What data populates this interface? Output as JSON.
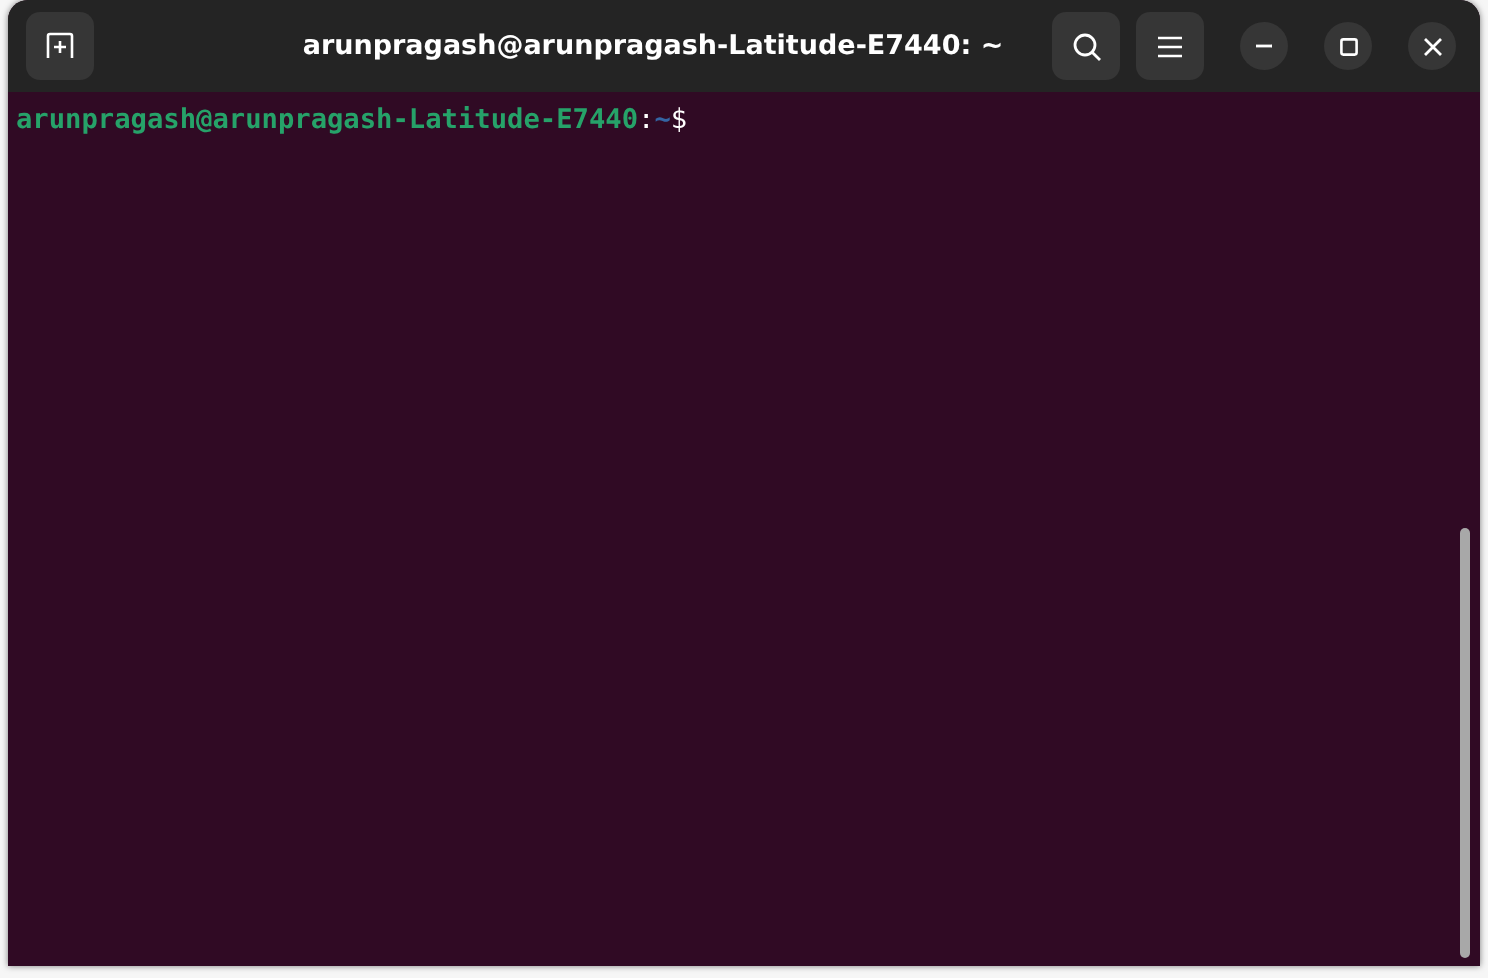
{
  "window": {
    "title": "arunpragash@arunpragash-Latitude-E7440: ~"
  },
  "terminal": {
    "prompt": {
      "user_host": "arunpragash@arunpragash-Latitude-E7440",
      "separator": ":",
      "path": "~",
      "symbol": "$"
    }
  }
}
